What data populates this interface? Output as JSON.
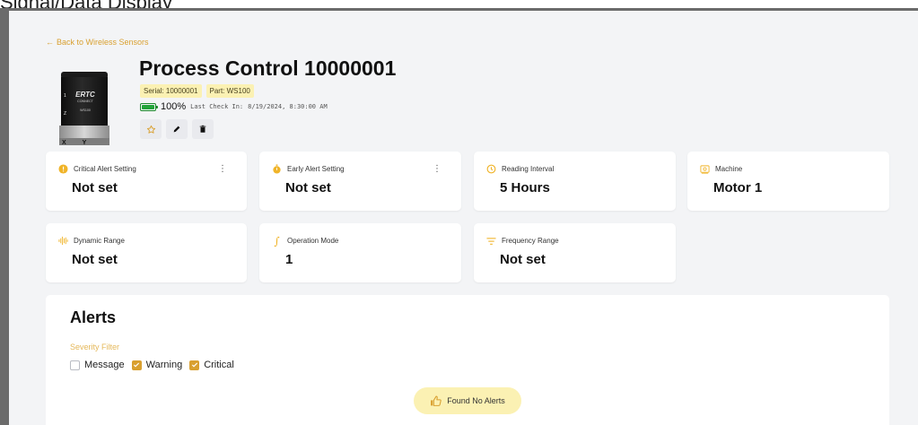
{
  "header": {
    "fragment_text": "Signal/Data Display"
  },
  "nav": {
    "back_label": "Back to Wireless Sensors"
  },
  "sensor": {
    "title": "Process Control 10000001",
    "serial_label": "Serial: 10000001",
    "part_label": "Part: WS100",
    "battery_percent": 100,
    "battery_label": "100%",
    "last_checkin_label": "Last Check In:",
    "last_checkin_value": "8/19/2024, 8:30:00 AM",
    "image_brand": "ERTC CONNECT",
    "image_model": "WS100",
    "image_axes": [
      "Y",
      "X",
      "Z"
    ]
  },
  "actions": {
    "star_icon": "star-icon",
    "edit_icon": "pencil-icon",
    "delete_icon": "trash-icon"
  },
  "cards": [
    {
      "label": "Critical Alert Setting",
      "value": "Not set",
      "icon": "alert-circle-icon",
      "icon_color": "#f0b429",
      "has_menu": true
    },
    {
      "label": "Early Alert Setting",
      "value": "Not set",
      "icon": "stopwatch-icon",
      "icon_color": "#f0b429",
      "has_menu": true
    },
    {
      "label": "Reading Interval",
      "value": "5 Hours",
      "icon": "clock-icon",
      "icon_color": "#f0b429",
      "has_menu": false
    },
    {
      "label": "Machine",
      "value": "Motor 1",
      "icon": "machine-icon",
      "icon_color": "#f0b429",
      "has_menu": false
    },
    {
      "label": "Dynamic Range",
      "value": "Not set",
      "icon": "waveform-icon",
      "icon_color": "#f0b429",
      "has_menu": false
    },
    {
      "label": "Operation Mode",
      "value": "1",
      "icon": "integral-icon",
      "icon_color": "#f0b429",
      "has_menu": false
    },
    {
      "label": "Frequency Range",
      "value": "Not set",
      "icon": "filter-icon",
      "icon_color": "#f0b429",
      "has_menu": false
    }
  ],
  "alerts": {
    "title": "Alerts",
    "severity_label": "Severity Filter",
    "filters": [
      {
        "label": "Message",
        "checked": false
      },
      {
        "label": "Warning",
        "checked": true
      },
      {
        "label": "Critical",
        "checked": true
      }
    ],
    "empty_label": "Found No Alerts"
  },
  "colors": {
    "accent": "#d9a030",
    "badge_bg": "#fbf1b3",
    "battery_green": "#22a33a",
    "page_bg": "#f3f4f6"
  }
}
